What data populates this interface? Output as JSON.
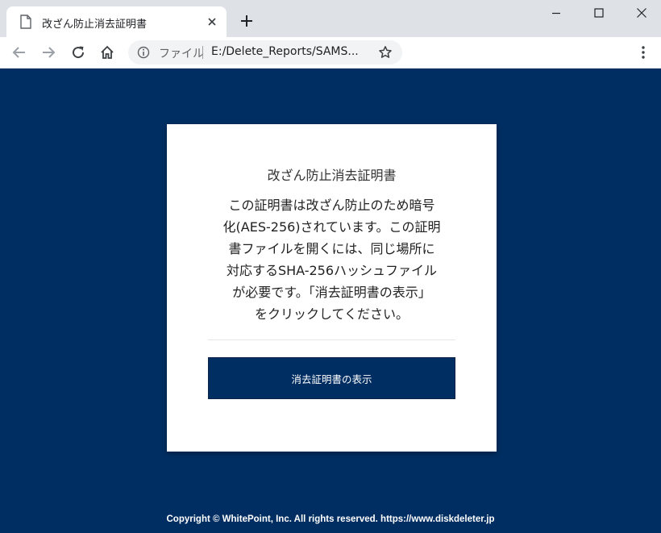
{
  "browser": {
    "tab": {
      "title": "改ざん防止消去証明書"
    },
    "omnibox": {
      "scheme_label": "ファイル",
      "url": "E:/Delete_Reports/SAMS..."
    }
  },
  "card": {
    "title": "改ざん防止消去証明書",
    "body_lines": [
      "この証明書は改ざん防止のため暗号",
      "化(AES-256)されています。この証明",
      "書ファイルを開くには、同じ場所に",
      "対応するSHA-256ハッシュファイル",
      "が必要です。「消去証明書の表示」",
      "をクリックしてください。"
    ],
    "button_label": "消去証明書の表示"
  },
  "footer": {
    "text": "Copyright © WhitePoint, Inc. All rights reserved. https://www.diskdeleter.jp"
  },
  "colors": {
    "page_background": "#002e62",
    "button_background": "#002e62",
    "tabbar_background": "#dee1e6"
  }
}
